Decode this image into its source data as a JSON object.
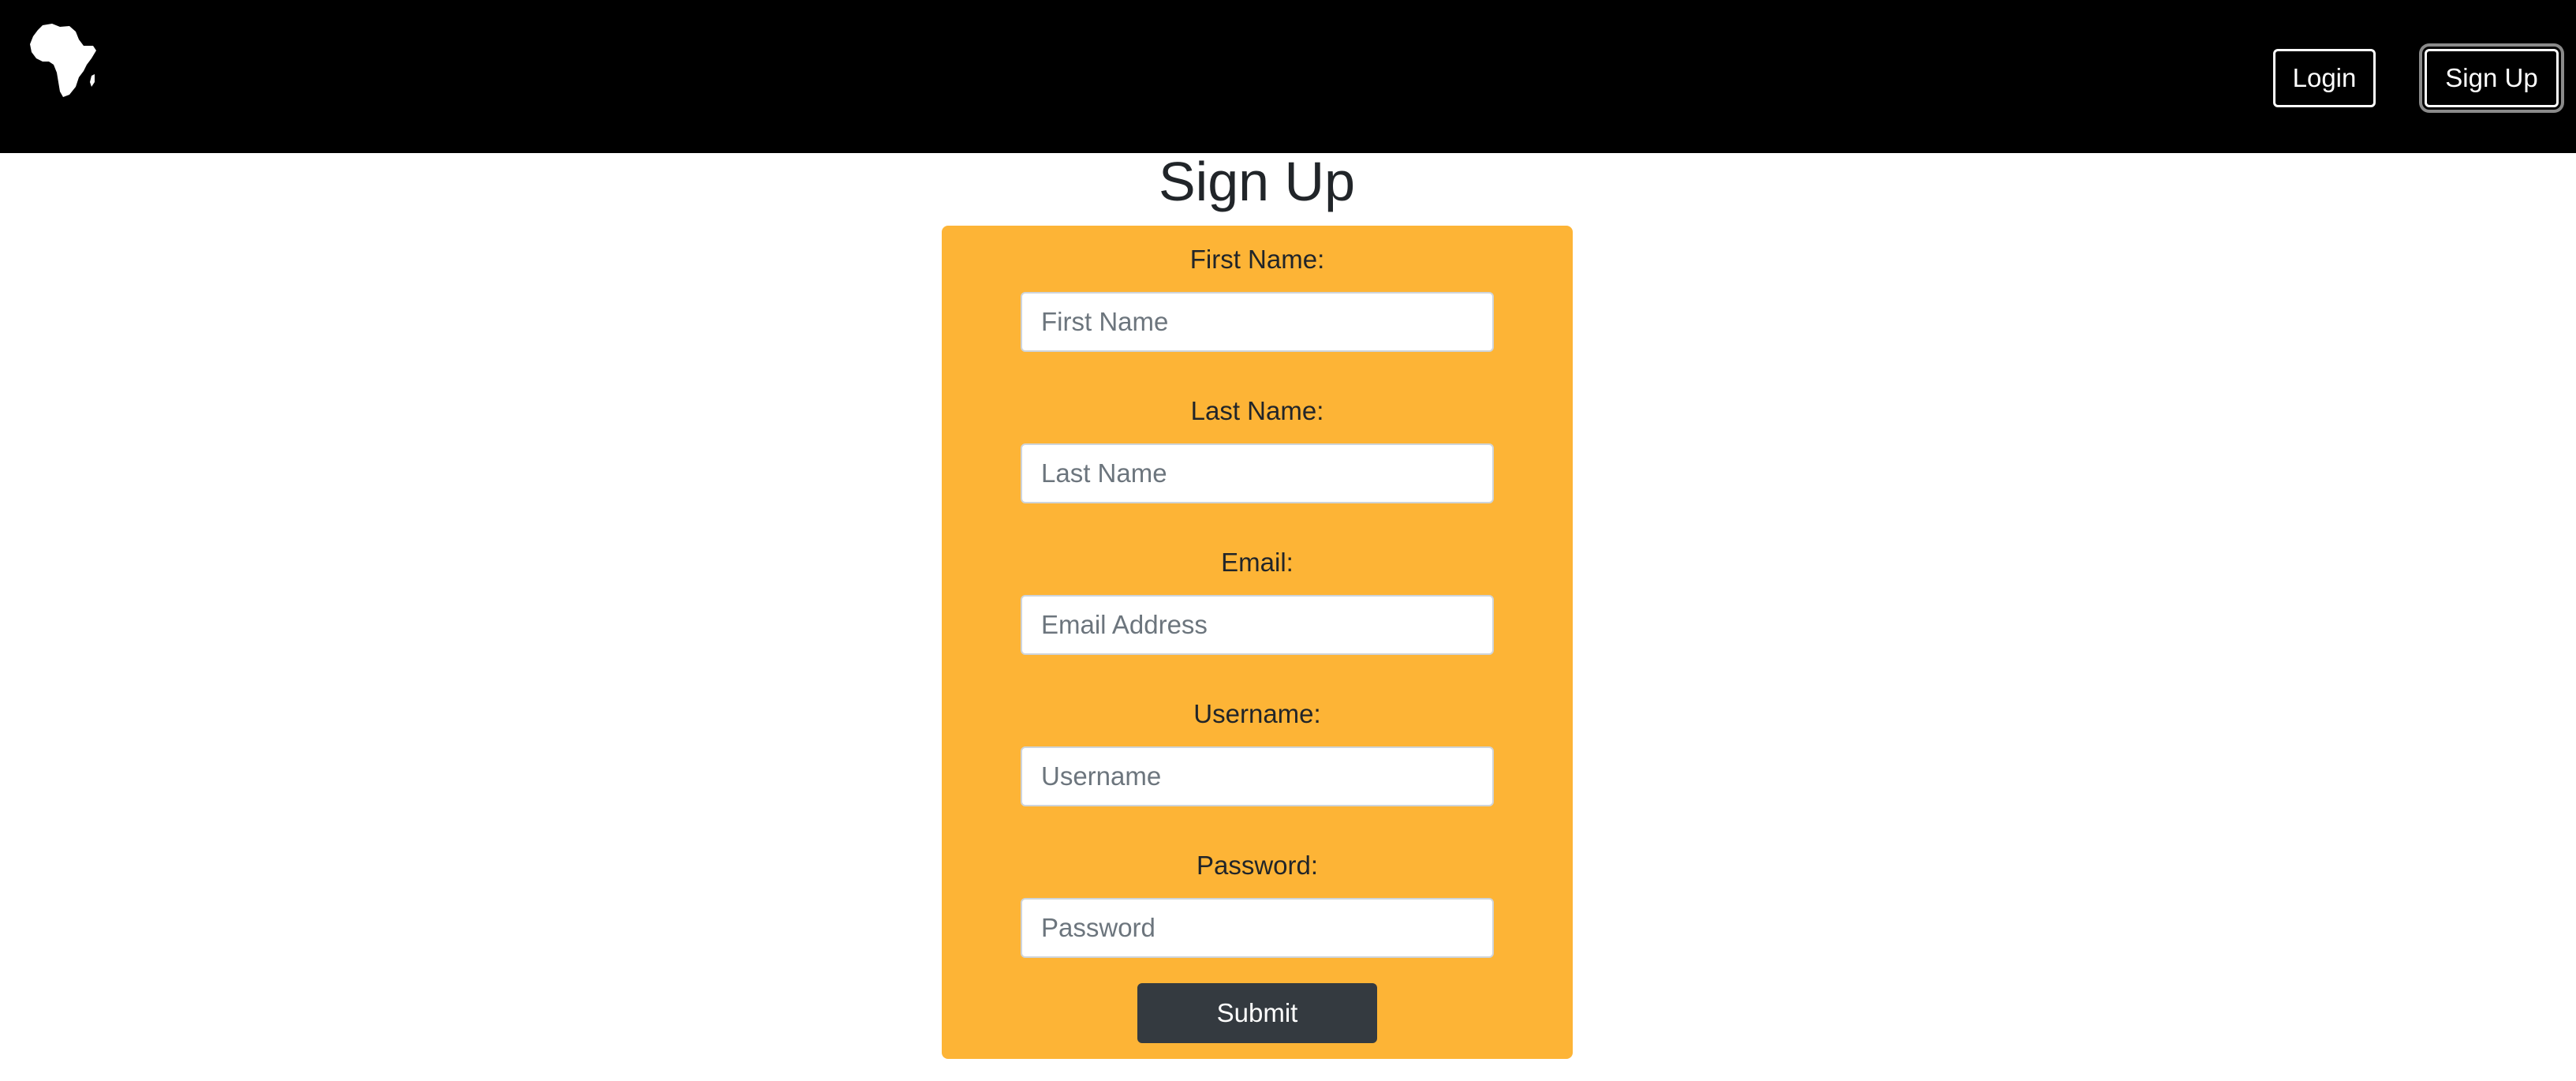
{
  "header": {
    "logo_icon": "africa-continent-icon",
    "login_label": "Login",
    "signup_label": "Sign Up"
  },
  "page": {
    "title": "Sign Up"
  },
  "form": {
    "fields": [
      {
        "label": "First Name:",
        "placeholder": "First Name",
        "value": ""
      },
      {
        "label": "Last Name:",
        "placeholder": "Last Name",
        "value": ""
      },
      {
        "label": "Email:",
        "placeholder": "Email Address",
        "value": ""
      },
      {
        "label": "Username:",
        "placeholder": "Username",
        "value": ""
      },
      {
        "label": "Password:",
        "placeholder": "Password",
        "value": ""
      }
    ],
    "submit_label": "Submit"
  },
  "colors": {
    "navbar": "#000000",
    "form_background": "#fdb436",
    "submit_button": "#343a40"
  }
}
